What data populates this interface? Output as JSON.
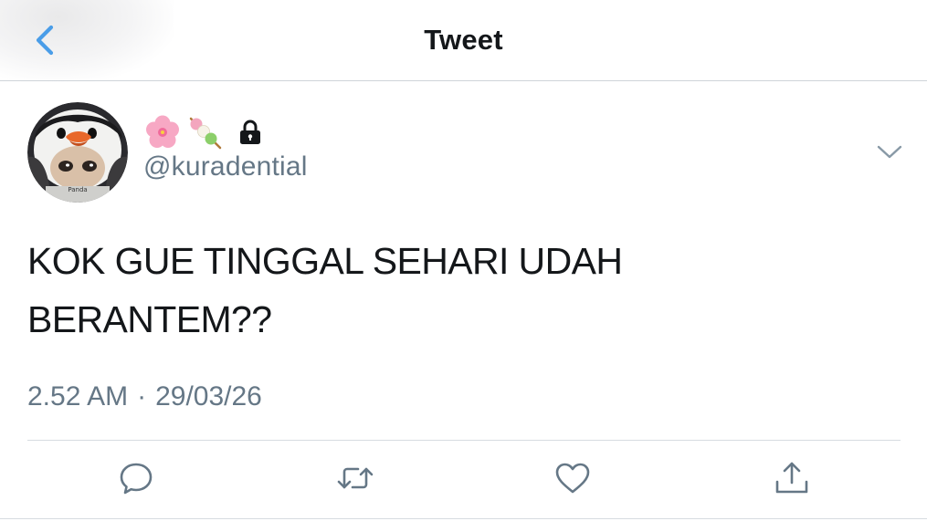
{
  "header": {
    "title": "Tweet",
    "back_icon": "chevron-left-icon",
    "accent_color": "#4a9de8"
  },
  "author": {
    "avatar_icon": "penguin-costume-avatar",
    "emojis": [
      "cherry-blossom-emoji",
      "dango-emoji"
    ],
    "protected_icon": "lock-icon",
    "handle": "@kuradential",
    "menu_icon": "chevron-down-icon"
  },
  "tweet": {
    "text_line1": "KOK GUE TINGGAL SEHARI UDAH",
    "text_line2": "BERANTEM??",
    "time": "2.52 AM",
    "separator": "·",
    "date": "29/03/26"
  },
  "actions": [
    "reply-icon",
    "retweet-icon",
    "like-icon",
    "share-icon"
  ],
  "colors": {
    "text": "#14171a",
    "secondary_text": "#657786",
    "divider": "#d6dbe0"
  }
}
